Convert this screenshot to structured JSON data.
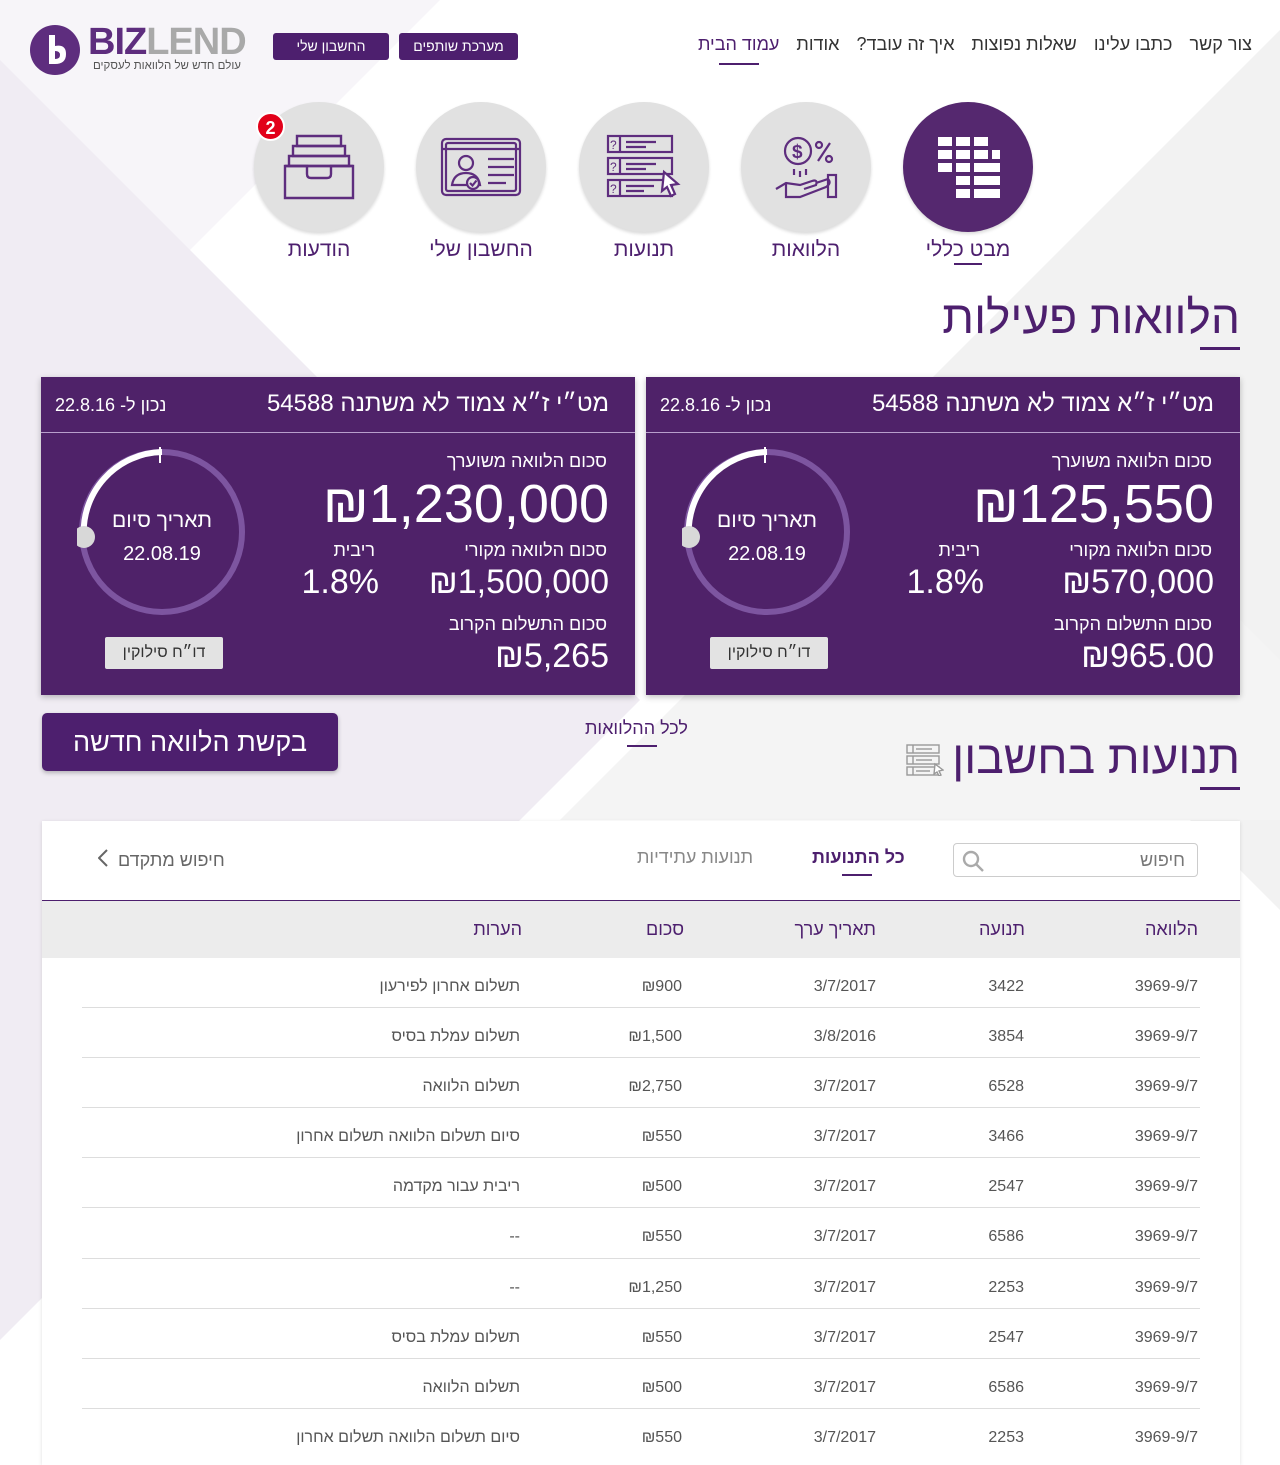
{
  "header": {
    "logo": {
      "brand_a": "BIZ",
      "brand_b": "LEND",
      "tagline": "עולם חדש של הלוואות לעסקים"
    },
    "buttons": {
      "my_account": "החשבון שלי",
      "partners": "מערכת שותפים"
    },
    "nav": [
      "עמוד הבית",
      "אודות",
      "איך זה עובד?",
      "שאלות נפוצות",
      "כתבו עלינו",
      "צור קשר"
    ]
  },
  "iconnav": {
    "overview": "מבט כללי",
    "loans": "הלוואות",
    "transactions": "תנועות",
    "account": "החשבון שלי",
    "messages": "הודעות",
    "messages_badge": "2"
  },
  "active_loans": {
    "title": "הלוואות פעילות",
    "cards": [
      {
        "title": "מט״י ז״א צמוד לא משתנה 54588",
        "as_of": "נכון ל- 22.8.16",
        "est_label": "סכום הלוואה משוערך",
        "est_value": "125,550",
        "orig_label": "סכום הלוואה מקורי",
        "orig_value": "570,000",
        "rate_label": "ריבית",
        "rate_value": "1.8%",
        "next_label": "סכום התשלום הקרוב",
        "next_value": "965.00",
        "end_label": "תאריך סיום",
        "end_value": "22.08.19",
        "report_btn": "דו״ח סילוקין"
      },
      {
        "title": "מט״י ז״א צמוד לא משתנה 54588",
        "as_of": "נכון ל- 22.8.16",
        "est_label": "סכום הלוואה משוערך",
        "est_value": "1,230,000",
        "orig_label": "סכום הלוואה מקורי",
        "orig_value": "1,500,000",
        "rate_label": "ריבית",
        "rate_value": "1.8%",
        "next_label": "סכום התשלום הקרוב",
        "next_value": "5,265",
        "end_label": "תאריך סיום",
        "end_value": "22.08.19",
        "report_btn": "דו״ח סילוקין"
      }
    ],
    "currency": "₪",
    "all_loans_link": "לכל ההלוואות",
    "new_loan_btn": "בקשת הלוואה חדשה"
  },
  "transactions": {
    "title": "תנועות בחשבון",
    "search_placeholder": "חיפוש",
    "tab_all": "כל התנועות",
    "tab_future": "תנועות עתידיות",
    "advanced": "חיפוש מתקדם",
    "columns": {
      "loan": "הלוואה",
      "tx": "תנועה",
      "date": "תאריך ערך",
      "amount": "סכום",
      "notes": "הערות"
    },
    "rows": [
      {
        "loan": "3969-9/7",
        "tx": "3422",
        "date": "3/7/2017",
        "amount": "₪900",
        "notes": "תשלום אחרון לפירעון"
      },
      {
        "loan": "3969-9/7",
        "tx": "3854",
        "date": "3/8/2016",
        "amount": "₪1,500",
        "notes": "תשלום עמלת בסיס"
      },
      {
        "loan": "3969-9/7",
        "tx": "6528",
        "date": "3/7/2017",
        "amount": "₪2,750",
        "notes": "תשלום הלוואה"
      },
      {
        "loan": "3969-9/7",
        "tx": "3466",
        "date": "3/7/2017",
        "amount": "₪550",
        "notes": "סיום תשלום הלוואה תשלום אחרון"
      },
      {
        "loan": "3969-9/7",
        "tx": "2547",
        "date": "3/7/2017",
        "amount": "₪500",
        "notes": "ריבית עבור מקדמה"
      },
      {
        "loan": "3969-9/7",
        "tx": "6586",
        "date": "3/7/2017",
        "amount": "₪550",
        "notes": "--"
      },
      {
        "loan": "3969-9/7",
        "tx": "2253",
        "date": "3/7/2017",
        "amount": "₪1,250",
        "notes": "--"
      },
      {
        "loan": "3969-9/7",
        "tx": "2547",
        "date": "3/7/2017",
        "amount": "₪550",
        "notes": "תשלום עמלת בסיס"
      },
      {
        "loan": "3969-9/7",
        "tx": "6586",
        "date": "3/7/2017",
        "amount": "₪500",
        "notes": "תשלום הלוואה"
      },
      {
        "loan": "3969-9/7",
        "tx": "2253",
        "date": "3/7/2017",
        "amount": "₪550",
        "notes": "סיום תשלום הלוואה תשלום אחרון"
      }
    ]
  },
  "colors": {
    "brand": "#4d1f6e",
    "card_bg": "#4f2269",
    "badge": "#e2001a",
    "icon_circle": "#e1e1e1"
  }
}
